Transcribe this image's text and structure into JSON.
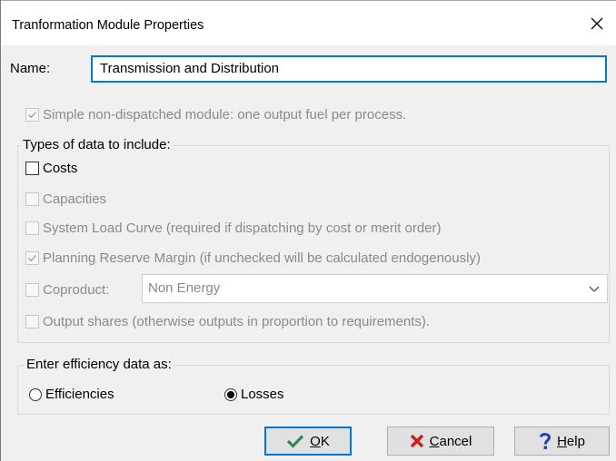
{
  "window": {
    "title": "Tranformation Module Properties"
  },
  "name_field": {
    "label": "Name:",
    "value": "Transmission and Distribution"
  },
  "simple_module": {
    "label": "Simple non-dispatched module: one output fuel per process.",
    "checked": true
  },
  "data_types": {
    "legend": "Types of data to include:",
    "costs": "Costs",
    "capacities": "Capacities",
    "system_load_curve": "System Load Curve (required if dispatching by cost or merit order)",
    "planning_reserve": "Planning Reserve Margin (if unchecked will be calculated endogenously)",
    "coproduct": "Coproduct:",
    "coproduct_value": "Non Energy",
    "output_shares": "Output shares (otherwise outputs in proportion to requirements)."
  },
  "efficiency": {
    "legend": "Enter efficiency data as:",
    "efficiencies": "Efficiencies",
    "losses": "Losses",
    "selected": "Losses"
  },
  "buttons": {
    "ok_mnemonic": "O",
    "ok_rest": "K",
    "cancel_mnemonic": "C",
    "cancel_rest": "ancel",
    "help_mnemonic": "H",
    "help_rest": "elp"
  },
  "colors": {
    "accent": "#0078d7",
    "check_green": "#2e8b57",
    "cancel_red": "#cc1f1f",
    "help_blue": "#1a3fbf"
  }
}
